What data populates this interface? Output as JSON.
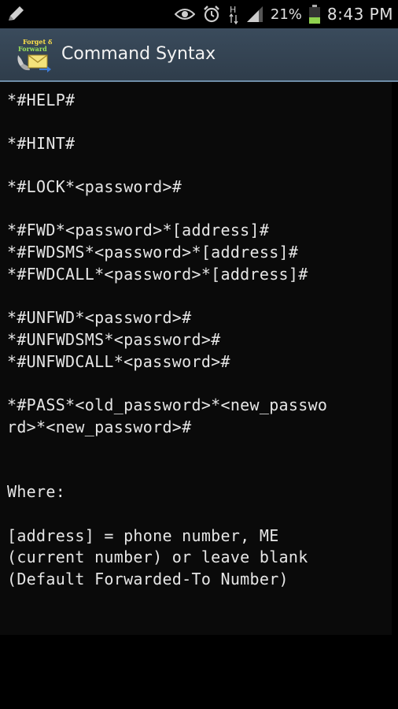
{
  "status_bar": {
    "battery_percent": "21%",
    "time": "8:43 PM",
    "icons": [
      "pencil-icon",
      "eye-icon",
      "alarm-icon",
      "hsdpa-icon",
      "signal-icon",
      "battery-icon"
    ],
    "network_label": "H"
  },
  "action_bar": {
    "title": "Command Syntax",
    "icon": "forget-and-forward-app-icon",
    "icon_text_line1": "Forget &",
    "icon_text_line2": "Forward",
    "color": "#34495c"
  },
  "content": {
    "lines": [
      "*#HELP#",
      "*#HINT#",
      "*#LOCK*<password>#",
      "*#FWD*<password>*[address]#",
      "*#FWDSMS*<password>*[address]#",
      "*#FWDCALL*<password>*[address]#",
      "*#UNFWD*<password>#",
      "*#UNFWDSMS*<password>#",
      "*#UNFWDCALL*<password>#",
      "*#PASS*<old_password>*<new_passwo",
      "rd>*<new_password>#",
      "Where:",
      "[address] = phone number, ME",
      "(current number) or leave blank",
      "(Default Forwarded-To Number)"
    ]
  }
}
